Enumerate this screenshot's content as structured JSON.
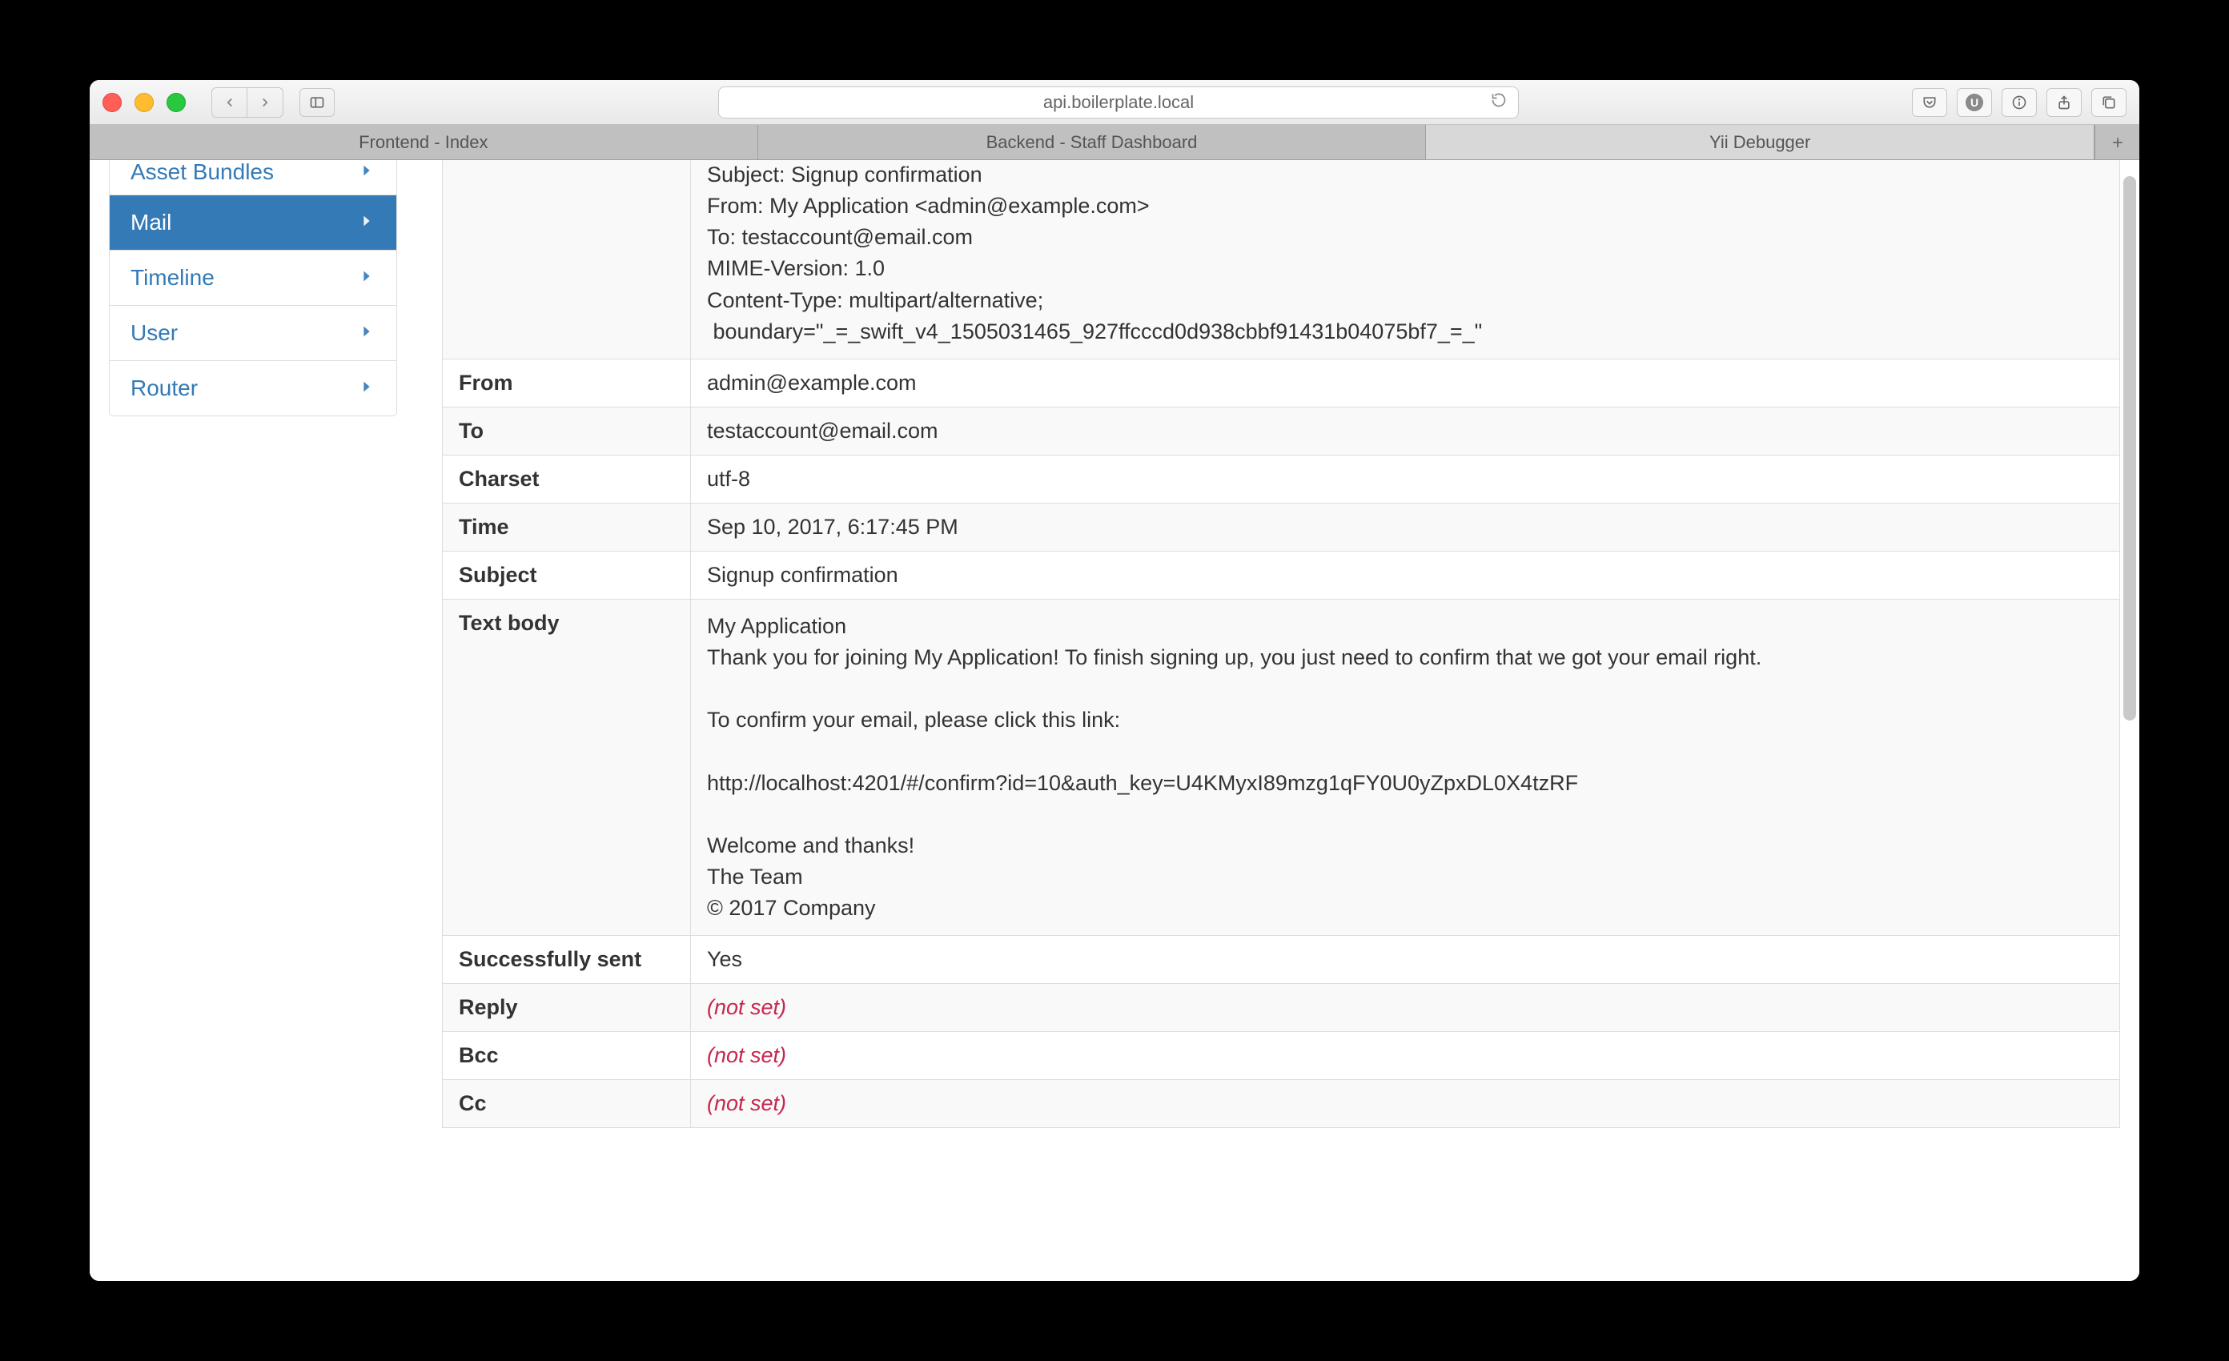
{
  "browser": {
    "url": "api.boilerplate.local",
    "tabs": [
      {
        "label": "Frontend - Index",
        "active": false
      },
      {
        "label": "Backend - Staff Dashboard",
        "active": false
      },
      {
        "label": "Yii Debugger",
        "active": true
      }
    ]
  },
  "sidebar": {
    "items": [
      {
        "label": "Asset Bundles",
        "active": false
      },
      {
        "label": "Mail",
        "active": true
      },
      {
        "label": "Timeline",
        "active": false
      },
      {
        "label": "User",
        "active": false
      },
      {
        "label": "Router",
        "active": false
      }
    ]
  },
  "headers_block": "Subject: Signup confirmation\nFrom: My Application <admin@example.com>\nTo: testaccount@email.com\nMIME-Version: 1.0\nContent-Type: multipart/alternative;\n boundary=\"_=_swift_v4_1505031465_927ffcccd0d938cbbf91431b04075bf7_=_\"",
  "rows": {
    "from_label": "From",
    "from_value": "admin@example.com",
    "to_label": "To",
    "to_value": "testaccount@email.com",
    "charset_label": "Charset",
    "charset_value": "utf-8",
    "time_label": "Time",
    "time_value": "Sep 10, 2017, 6:17:45 PM",
    "subject_label": "Subject",
    "subject_value": "Signup confirmation",
    "textbody_label": "Text body",
    "textbody_value": "My Application\nThank you for joining My Application! To finish signing up, you just need to confirm that we got your email right.\n\nTo confirm your email, please click this link:\n\nhttp://localhost:4201/#/confirm?id=10&auth_key=U4KMyxI89mzg1qFY0U0yZpxDL0X4tzRF\n\nWelcome and thanks!\nThe Team\n© 2017 Company",
    "sent_label": "Successfully sent",
    "sent_value": "Yes",
    "reply_label": "Reply",
    "reply_value": "(not set)",
    "bcc_label": "Bcc",
    "bcc_value": "(not set)",
    "cc_label": "Cc",
    "cc_value": "(not set)"
  }
}
